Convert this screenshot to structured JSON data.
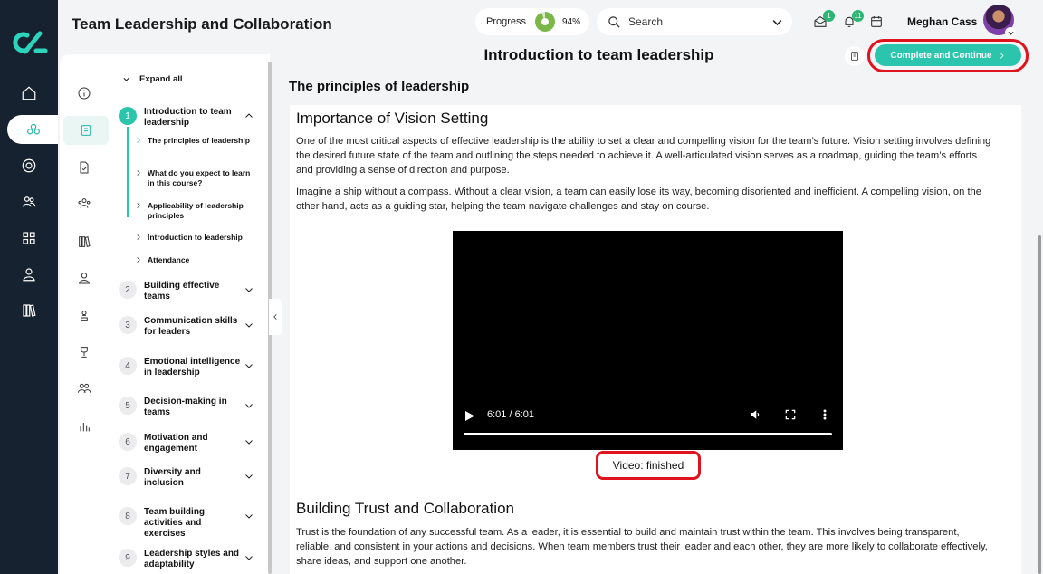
{
  "app": {
    "title": "Team Leadership and Collaboration"
  },
  "header": {
    "progress_label": "Progress",
    "progress_value": "94%",
    "progress_fraction": 0.94,
    "search_placeholder": "Search",
    "messages_badge": "1",
    "notifications_badge": "11",
    "user_name": "Meghan Cass"
  },
  "outline": {
    "expand_all": "Expand all",
    "modules": [
      {
        "num": "1",
        "title": "Introduction to team leadership",
        "expanded": true
      },
      {
        "num": "2",
        "title": "Building effective teams"
      },
      {
        "num": "3",
        "title": "Communication skills for leaders"
      },
      {
        "num": "4",
        "title": "Emotional intelligence in leadership"
      },
      {
        "num": "5",
        "title": "Decision-making in teams"
      },
      {
        "num": "6",
        "title": "Motivation and engagement"
      },
      {
        "num": "7",
        "title": "Diversity and inclusion"
      },
      {
        "num": "8",
        "title": "Team building activities and exercises"
      },
      {
        "num": "9",
        "title": "Leadership styles and adaptability"
      }
    ],
    "lessons": [
      {
        "title": "The principles of leadership",
        "active": true
      },
      {
        "title": "What do you expect to learn in this course?"
      },
      {
        "title": "Applicability of leadership principles"
      },
      {
        "title": "Introduction to leadership"
      },
      {
        "title": "Attendance"
      }
    ]
  },
  "content": {
    "lesson_title": "Introduction to team leadership",
    "complete_button": "Complete and Continue",
    "section_title": "The principles of leadership",
    "h1": "Importance of Vision Setting",
    "p1": "One of the most critical aspects of effective leadership is the ability to set a clear and compelling vision for the team’s future. Vision setting involves defining the desired future state of the team and outlining the steps needed to achieve it. A well-articulated vision serves as a roadmap, guiding the team’s efforts and providing a sense of direction and purpose.",
    "p2": "Imagine a ship without a compass. Without a clear vision, a team can easily lose its way, becoming disoriented and inefficient. A compelling vision, on the other hand, acts as a guiding star, helping the team navigate challenges and stay on course.",
    "video_time": "6:01 / 6:01",
    "video_progress": 1.0,
    "video_status": "Video: finished",
    "h2": "Building Trust and Collaboration",
    "p3": "Trust is the foundation of any successful team. As a leader, it is essential to build and maintain trust within the team. This involves being transparent, reliable, and consistent in your actions and decisions. When team members trust their leader and each other, they are more likely to collaborate effectively, share ideas, and support one another."
  },
  "colors": {
    "accent": "#2bc4ad",
    "rail": "#172230",
    "highlight": "#e0141e",
    "progress": "#7ab648"
  }
}
